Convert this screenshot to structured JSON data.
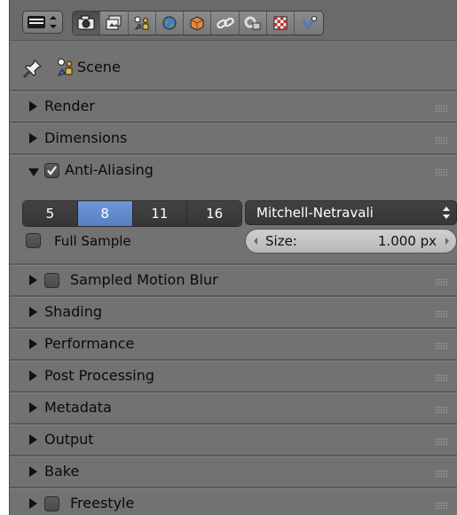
{
  "context_tabs": [
    {
      "icon": "render-camera-icon",
      "active": true
    },
    {
      "icon": "render-layers-icon",
      "active": false
    },
    {
      "icon": "scene-icon",
      "active": false
    },
    {
      "icon": "world-icon",
      "active": false
    },
    {
      "icon": "object-icon",
      "active": false
    },
    {
      "icon": "constraints-icon",
      "active": false
    },
    {
      "icon": "modifiers-icon",
      "active": false
    },
    {
      "icon": "texture-icon",
      "active": false
    },
    {
      "icon": "particles-icon",
      "active": false
    }
  ],
  "breadcrumb": {
    "scene_label": "Scene"
  },
  "panels": {
    "render": "Render",
    "dimensions": "Dimensions",
    "anti_aliasing": "Anti-Aliasing",
    "sampled_motion_blur": "Sampled Motion Blur",
    "shading": "Shading",
    "performance": "Performance",
    "post_processing": "Post Processing",
    "metadata": "Metadata",
    "output": "Output",
    "bake": "Bake",
    "freestyle": "Freestyle"
  },
  "anti_aliasing": {
    "enabled": true,
    "samples": [
      "5",
      "8",
      "11",
      "16"
    ],
    "selected_sample": "8",
    "filter": "Mitchell-Netravali",
    "full_sample_label": "Full Sample",
    "full_sample_checked": false,
    "size_label": "Size:",
    "size_value": "1.000 px"
  },
  "colors": {
    "panel_bg": "#727272",
    "selected_blue": "#5f89cc",
    "dark_button": "#3c3c3c"
  }
}
